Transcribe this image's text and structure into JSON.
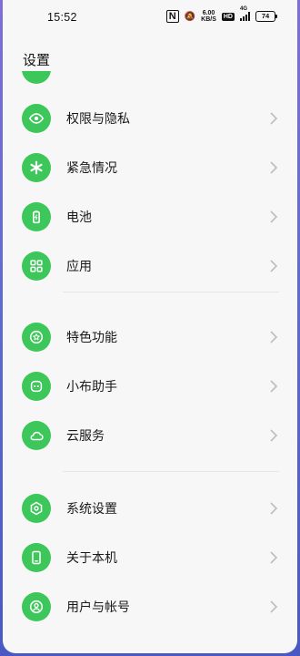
{
  "status_bar": {
    "time": "15:52",
    "nfc_label": "N",
    "net_speed_value": "6.00",
    "net_speed_unit": "KB/S",
    "hd_label": "HD",
    "signal_label": "4G",
    "battery": "74"
  },
  "header": {
    "title": "设置"
  },
  "items": [
    {
      "label": "权限与隐私",
      "icon": "privacy-eye-icon"
    },
    {
      "label": "紧急情况",
      "icon": "emergency-asterisk-icon"
    },
    {
      "label": "电池",
      "icon": "battery-icon"
    },
    {
      "label": "应用",
      "icon": "apps-grid-icon"
    },
    {
      "label": "特色功能",
      "icon": "star-badge-icon"
    },
    {
      "label": "小布助手",
      "icon": "assistant-icon"
    },
    {
      "label": "云服务",
      "icon": "cloud-icon"
    },
    {
      "label": "系统设置",
      "icon": "system-hexagon-icon"
    },
    {
      "label": "关于本机",
      "icon": "phone-icon"
    },
    {
      "label": "用户与帐号",
      "icon": "user-icon"
    }
  ],
  "colors": {
    "icon_bg": "#3dc75a",
    "background": "#f7f7f7",
    "frame": "#5e6bd0"
  }
}
